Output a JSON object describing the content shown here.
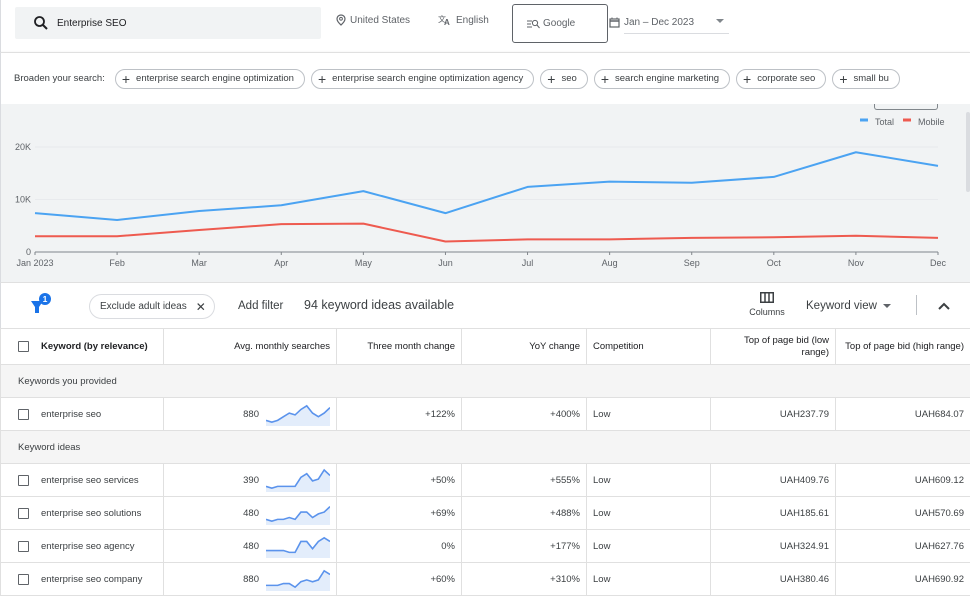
{
  "search": {
    "query": "Enterprise SEO",
    "location": "United States",
    "language": "English",
    "network": "Google",
    "date_range": "Jan – Dec 2023"
  },
  "broaden": {
    "label": "Broaden your search:",
    "chips": [
      "enterprise search engine optimization",
      "enterprise search engine optimization agency",
      "seo",
      "search engine marketing",
      "corporate seo",
      "small bu"
    ]
  },
  "chart_data": {
    "type": "line",
    "title": "",
    "xlabel": "",
    "ylabel": "",
    "categories": [
      "Jan 2023",
      "Feb",
      "Mar",
      "Apr",
      "May",
      "Jun",
      "Jul",
      "Aug",
      "Sep",
      "Oct",
      "Nov",
      "Dec"
    ],
    "y_ticks": [
      "0",
      "10K",
      "20K"
    ],
    "ylim": [
      0,
      20000
    ],
    "grid": true,
    "legend_position": "top-right",
    "series": [
      {
        "name": "Total",
        "color": "#4ba3f2",
        "values": [
          7400,
          6100,
          7800,
          8900,
          11600,
          7400,
          12400,
          13400,
          13200,
          14300,
          19000,
          16400
        ]
      },
      {
        "name": "Mobile",
        "color": "#ee5a4f",
        "values": [
          3000,
          3000,
          4200,
          5300,
          5400,
          2000,
          2400,
          2400,
          2700,
          2800,
          3100,
          2700
        ]
      }
    ]
  },
  "filters": {
    "active_count": "1",
    "chip_label": "Exclude adult ideas",
    "add_filter": "Add filter",
    "ideas_available": "94 keyword ideas available",
    "columns_label": "Columns",
    "view_label": "Keyword view"
  },
  "table": {
    "headers": [
      "Keyword (by relevance)",
      "Avg. monthly searches",
      "Three month change",
      "YoY change",
      "Competition",
      "Top of page bid (low range)",
      "Top of page bid (high range)"
    ],
    "sections": [
      {
        "title": "Keywords you provided",
        "rows": [
          {
            "keyword": "enterprise seo",
            "searches": "880",
            "trend": [
              2,
              1,
              2,
              4,
              6,
              5,
              8,
              10,
              6,
              4,
              6,
              9
            ],
            "three_month": "+122%",
            "yoy": "+400%",
            "competition": "Low",
            "bid_low": "UAH237.79",
            "bid_high": "UAH684.07"
          }
        ]
      },
      {
        "title": "Keyword ideas",
        "rows": [
          {
            "keyword": "enterprise seo services",
            "searches": "390",
            "trend": [
              2,
              1,
              2,
              2,
              2,
              2,
              7,
              9,
              5,
              6,
              11,
              8
            ],
            "three_month": "+50%",
            "yoy": "+555%",
            "competition": "Low",
            "bid_low": "UAH409.76",
            "bid_high": "UAH609.12"
          },
          {
            "keyword": "enterprise seo solutions",
            "searches": "480",
            "trend": [
              2,
              1,
              2,
              2,
              3,
              2,
              6,
              6,
              3,
              5,
              6,
              9
            ],
            "three_month": "+69%",
            "yoy": "+488%",
            "competition": "Low",
            "bid_low": "UAH185.61",
            "bid_high": "UAH570.69"
          },
          {
            "keyword": "enterprise seo agency",
            "searches": "480",
            "trend": [
              3,
              3,
              3,
              3,
              2,
              2,
              8,
              8,
              4,
              8,
              10,
              8
            ],
            "three_month": "0%",
            "yoy": "+177%",
            "competition": "Low",
            "bid_low": "UAH324.91",
            "bid_high": "UAH627.76"
          },
          {
            "keyword": "enterprise seo company",
            "searches": "880",
            "trend": [
              2,
              2,
              2,
              3,
              3,
              1,
              4,
              5,
              4,
              5,
              10,
              8
            ],
            "three_month": "+60%",
            "yoy": "+310%",
            "competition": "Low",
            "bid_low": "UAH380.46",
            "bid_high": "UAH690.92"
          }
        ]
      }
    ]
  }
}
